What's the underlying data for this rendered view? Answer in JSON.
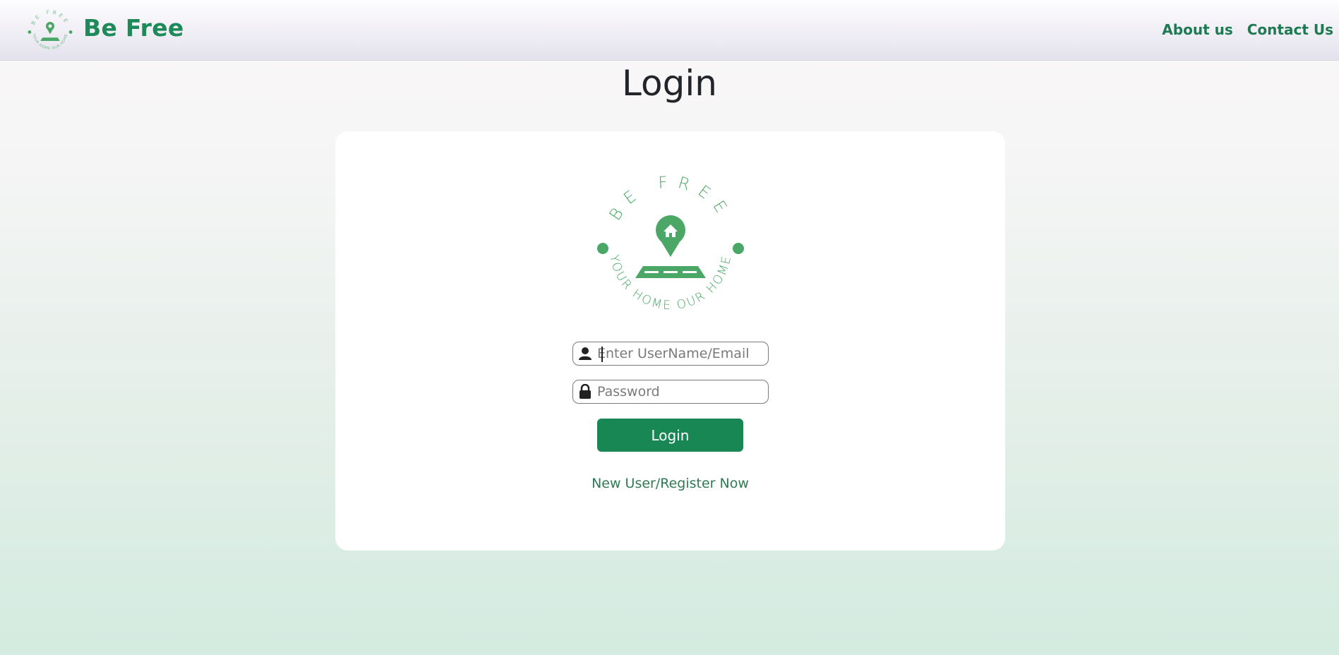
{
  "nav": {
    "brand_name": "Be Free",
    "links": [
      "About us",
      "Contact Us"
    ]
  },
  "logo": {
    "top_text": "BE   FREE",
    "bottom_text": "YOUR HOME OUR HOME"
  },
  "page": {
    "title": "Login"
  },
  "form": {
    "username_placeholder": "Enter UserName/Email",
    "username_value": "",
    "password_placeholder": "Password",
    "password_value": "",
    "login_label": "Login",
    "register_label": "New User/Register Now"
  },
  "colors": {
    "brand": "#1e8a5a",
    "logo_green": "#4aa765",
    "button": "#198754",
    "link": "#2f7a55"
  },
  "icons": {
    "username": "user-icon",
    "password": "lock-icon"
  }
}
